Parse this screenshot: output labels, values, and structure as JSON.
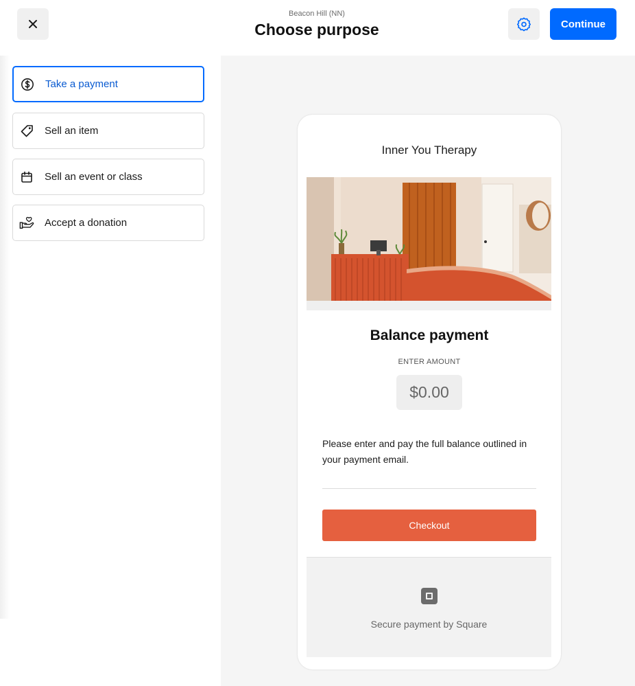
{
  "header": {
    "subtitle": "Beacon Hill (NN)",
    "title": "Choose purpose",
    "continue_label": "Continue",
    "close_icon": "close-icon",
    "settings_icon": "gear-icon"
  },
  "purposes": [
    {
      "label": "Take a payment",
      "icon": "dollar-circle-icon",
      "selected": true
    },
    {
      "label": "Sell an item",
      "icon": "tag-icon",
      "selected": false
    },
    {
      "label": "Sell an event or class",
      "icon": "calendar-icon",
      "selected": false
    },
    {
      "label": "Accept a donation",
      "icon": "donation-hand-icon",
      "selected": false
    }
  ],
  "preview": {
    "business_name": "Inner You Therapy",
    "heading": "Balance payment",
    "amount_label": "ENTER AMOUNT",
    "amount_value": "$0.00",
    "description": "Please enter and pay the full balance outlined in your payment email.",
    "checkout_label": "Checkout",
    "footer_text": "Secure payment by Square"
  },
  "colors": {
    "accent": "#006aff",
    "checkout": "#e5603f"
  }
}
